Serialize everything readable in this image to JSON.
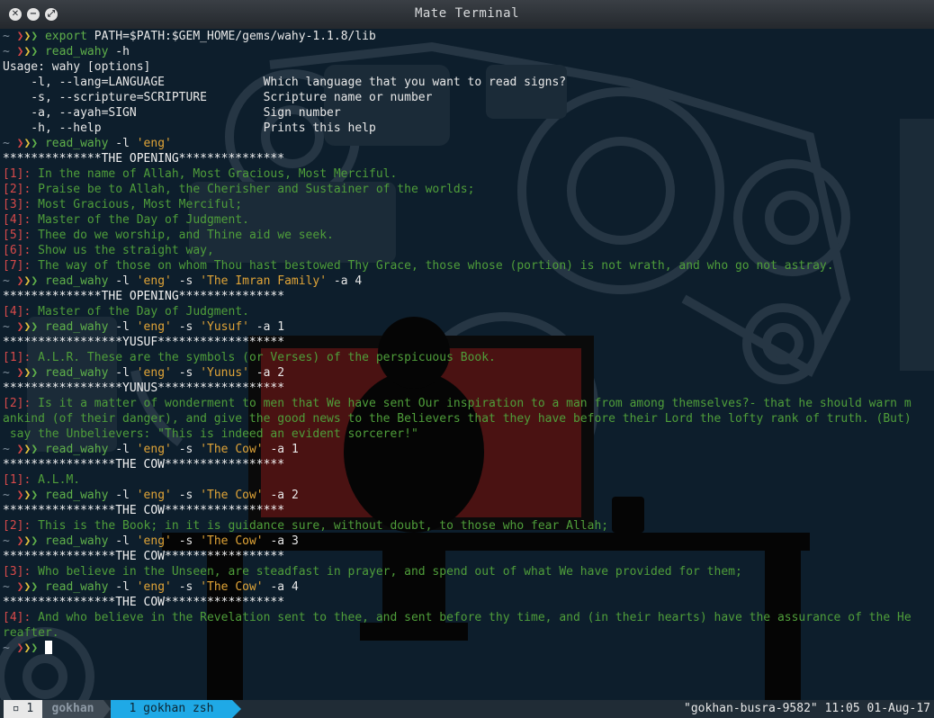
{
  "window": {
    "title": "Mate Terminal"
  },
  "prompt": {
    "tilde": "~",
    "arrows": [
      "❯",
      "❯",
      "❯"
    ]
  },
  "terminal": {
    "lines": [
      {
        "t": "p",
        "segs": [
          {
            "c": "cmd",
            "x": "export "
          },
          {
            "c": "t",
            "x": "PATH=$PATH:$GEM_HOME/gems/wahy-1.1.8/lib"
          }
        ]
      },
      {
        "t": "p",
        "segs": [
          {
            "c": "cmd",
            "x": "read_wahy "
          },
          {
            "c": "t",
            "x": "-h"
          }
        ]
      },
      {
        "t": "o",
        "segs": [
          {
            "c": "t",
            "x": "Usage: wahy [options]"
          }
        ]
      },
      {
        "t": "o",
        "segs": [
          {
            "c": "t",
            "x": "    -l, --lang=LANGUAGE              Which language that you want to read signs?"
          }
        ]
      },
      {
        "t": "o",
        "segs": [
          {
            "c": "t",
            "x": "    -s, --scripture=SCRIPTURE        Scripture name or number"
          }
        ]
      },
      {
        "t": "o",
        "segs": [
          {
            "c": "t",
            "x": "    -a, --ayah=SIGN                  Sign number"
          }
        ]
      },
      {
        "t": "o",
        "segs": [
          {
            "c": "t",
            "x": "    -h, --help                       Prints this help"
          }
        ]
      },
      {
        "t": "p",
        "segs": [
          {
            "c": "cmd",
            "x": "read_wahy "
          },
          {
            "c": "t",
            "x": "-l "
          },
          {
            "c": "str",
            "x": "'eng'"
          }
        ]
      },
      {
        "t": "o",
        "segs": [
          {
            "c": "hdr",
            "x": "**************THE OPENING***************"
          }
        ]
      },
      {
        "t": "o",
        "segs": [
          {
            "c": "num",
            "x": "[1]: "
          },
          {
            "c": "verse",
            "x": "In the name of Allah, Most Gracious, Most Merciful."
          }
        ]
      },
      {
        "t": "o",
        "segs": [
          {
            "c": "num",
            "x": "[2]: "
          },
          {
            "c": "verse",
            "x": "Praise be to Allah, the Cherisher and Sustainer of the worlds;"
          }
        ]
      },
      {
        "t": "o",
        "segs": [
          {
            "c": "num",
            "x": "[3]: "
          },
          {
            "c": "verse",
            "x": "Most Gracious, Most Merciful;"
          }
        ]
      },
      {
        "t": "o",
        "segs": [
          {
            "c": "num",
            "x": "[4]: "
          },
          {
            "c": "verse",
            "x": "Master of the Day of Judgment."
          }
        ]
      },
      {
        "t": "o",
        "segs": [
          {
            "c": "num",
            "x": "[5]: "
          },
          {
            "c": "verse",
            "x": "Thee do we worship, and Thine aid we seek."
          }
        ]
      },
      {
        "t": "o",
        "segs": [
          {
            "c": "num",
            "x": "[6]: "
          },
          {
            "c": "verse",
            "x": "Show us the straight way,"
          }
        ]
      },
      {
        "t": "o",
        "segs": [
          {
            "c": "num",
            "x": "[7]: "
          },
          {
            "c": "verse",
            "x": "The way of those on whom Thou hast bestowed Thy Grace, those whose (portion) is not wrath, and who go not astray."
          }
        ]
      },
      {
        "t": "p",
        "segs": [
          {
            "c": "cmd",
            "x": "read_wahy "
          },
          {
            "c": "t",
            "x": "-l "
          },
          {
            "c": "str",
            "x": "'eng'"
          },
          {
            "c": "t",
            "x": " -s "
          },
          {
            "c": "str",
            "x": "'The Imran Family'"
          },
          {
            "c": "t",
            "x": " -a 4"
          }
        ]
      },
      {
        "t": "o",
        "segs": [
          {
            "c": "hdr",
            "x": "**************THE OPENING***************"
          }
        ]
      },
      {
        "t": "o",
        "segs": [
          {
            "c": "num",
            "x": "[4]: "
          },
          {
            "c": "verse",
            "x": "Master of the Day of Judgment."
          }
        ]
      },
      {
        "t": "p",
        "segs": [
          {
            "c": "cmd",
            "x": "read_wahy "
          },
          {
            "c": "t",
            "x": "-l "
          },
          {
            "c": "str",
            "x": "'eng'"
          },
          {
            "c": "t",
            "x": " -s "
          },
          {
            "c": "str",
            "x": "'Yusuf'"
          },
          {
            "c": "t",
            "x": " -a 1"
          }
        ]
      },
      {
        "t": "o",
        "segs": [
          {
            "c": "hdr",
            "x": "*****************YUSUF******************"
          }
        ]
      },
      {
        "t": "o",
        "segs": [
          {
            "c": "num",
            "x": "[1]: "
          },
          {
            "c": "verse",
            "x": "A.L.R. These are the symbols (or Verses) of the perspicuous Book."
          }
        ]
      },
      {
        "t": "p",
        "segs": [
          {
            "c": "cmd",
            "x": "read_wahy "
          },
          {
            "c": "t",
            "x": "-l "
          },
          {
            "c": "str",
            "x": "'eng'"
          },
          {
            "c": "t",
            "x": " -s "
          },
          {
            "c": "str",
            "x": "'Yunus'"
          },
          {
            "c": "t",
            "x": " -a 2"
          }
        ]
      },
      {
        "t": "o",
        "segs": [
          {
            "c": "hdr",
            "x": "*****************YUNUS******************"
          }
        ]
      },
      {
        "t": "o",
        "segs": [
          {
            "c": "num",
            "x": "[2]: "
          },
          {
            "c": "verse",
            "x": "Is it a matter of wonderment to men that We have sent Our inspiration to a man from among themselves?- that he should warn m"
          }
        ]
      },
      {
        "t": "o",
        "segs": [
          {
            "c": "verse",
            "x": "ankind (of their danger), and give the good news to the Believers that they have before their Lord the lofty rank of truth. (But)"
          }
        ]
      },
      {
        "t": "o",
        "segs": [
          {
            "c": "verse",
            "x": " say the Unbelievers: \"This is indeed an evident sorcerer!\""
          }
        ]
      },
      {
        "t": "p",
        "segs": [
          {
            "c": "cmd",
            "x": "read_wahy "
          },
          {
            "c": "t",
            "x": "-l "
          },
          {
            "c": "str",
            "x": "'eng'"
          },
          {
            "c": "t",
            "x": " -s "
          },
          {
            "c": "str",
            "x": "'The Cow'"
          },
          {
            "c": "t",
            "x": " -a 1"
          }
        ]
      },
      {
        "t": "o",
        "segs": [
          {
            "c": "hdr",
            "x": "****************THE COW*****************"
          }
        ]
      },
      {
        "t": "o",
        "segs": [
          {
            "c": "num",
            "x": "[1]: "
          },
          {
            "c": "verse",
            "x": "A.L.M."
          }
        ]
      },
      {
        "t": "p",
        "segs": [
          {
            "c": "cmd",
            "x": "read_wahy "
          },
          {
            "c": "t",
            "x": "-l "
          },
          {
            "c": "str",
            "x": "'eng'"
          },
          {
            "c": "t",
            "x": " -s "
          },
          {
            "c": "str",
            "x": "'The Cow'"
          },
          {
            "c": "t",
            "x": " -a 2"
          }
        ]
      },
      {
        "t": "o",
        "segs": [
          {
            "c": "hdr",
            "x": "****************THE COW*****************"
          }
        ]
      },
      {
        "t": "o",
        "segs": [
          {
            "c": "num",
            "x": "[2]: "
          },
          {
            "c": "verse",
            "x": "This is the Book; in it is guidance sure, without doubt, to those who fear Allah;"
          }
        ]
      },
      {
        "t": "p",
        "segs": [
          {
            "c": "cmd",
            "x": "read_wahy "
          },
          {
            "c": "t",
            "x": "-l "
          },
          {
            "c": "str",
            "x": "'eng'"
          },
          {
            "c": "t",
            "x": " -s "
          },
          {
            "c": "str",
            "x": "'The Cow'"
          },
          {
            "c": "t",
            "x": " -a 3"
          }
        ]
      },
      {
        "t": "o",
        "segs": [
          {
            "c": "hdr",
            "x": "****************THE COW*****************"
          }
        ]
      },
      {
        "t": "o",
        "segs": [
          {
            "c": "num",
            "x": "[3]: "
          },
          {
            "c": "verse",
            "x": "Who believe in the Unseen, are steadfast in prayer, and spend out of what We have provided for them;"
          }
        ]
      },
      {
        "t": "p",
        "segs": [
          {
            "c": "cmd",
            "x": "read_wahy "
          },
          {
            "c": "t",
            "x": "-l "
          },
          {
            "c": "str",
            "x": "'eng'"
          },
          {
            "c": "t",
            "x": " -s "
          },
          {
            "c": "str",
            "x": "'The Cow'"
          },
          {
            "c": "t",
            "x": " -a 4"
          }
        ]
      },
      {
        "t": "o",
        "segs": [
          {
            "c": "hdr",
            "x": "****************THE COW*****************"
          }
        ]
      },
      {
        "t": "o",
        "segs": [
          {
            "c": "num",
            "x": "[4]: "
          },
          {
            "c": "verse",
            "x": "And who believe in the Revelation sent to thee, and sent before thy time, and (in their hearts) have the assurance of the He"
          }
        ]
      },
      {
        "t": "o",
        "segs": [
          {
            "c": "verse",
            "x": "reafter."
          }
        ]
      },
      {
        "t": "c",
        "segs": []
      }
    ]
  },
  "statusbar": {
    "window_index": "1",
    "user": "gokhan",
    "session": "1 gokhan zsh",
    "host": "\"gokhan-busra-9582\"",
    "time": "11:05",
    "date": "01-Aug-17"
  },
  "colors": {
    "background": "#0d1e2c",
    "prompt_arrow_red": "#d64545",
    "prompt_arrow_yellow": "#e0c23d",
    "prompt_arrow_green": "#5fb04a",
    "string": "#e0a437",
    "verse": "#4f9e3a",
    "session_tab": "#1fa9e6"
  }
}
